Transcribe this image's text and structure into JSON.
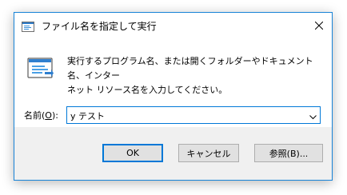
{
  "window": {
    "title": "ファイル名を指定して実行",
    "accent_color": "#0078d7"
  },
  "dialog": {
    "description_line1": "実行するプログラム名、または開くフォルダーやドキュメント名、インター",
    "description_line2": "ネット リソース名を入力してください。",
    "name_label_prefix": "名前(",
    "name_label_accel": "O",
    "name_label_suffix": "):",
    "input_value": "y テスト"
  },
  "buttons": {
    "ok": "OK",
    "cancel": "キャンセル",
    "browse": "参照(B)..."
  },
  "icons": {
    "title": "run-icon",
    "main": "run-icon",
    "close": "close-icon",
    "dropdown": "chevron-down-icon"
  }
}
